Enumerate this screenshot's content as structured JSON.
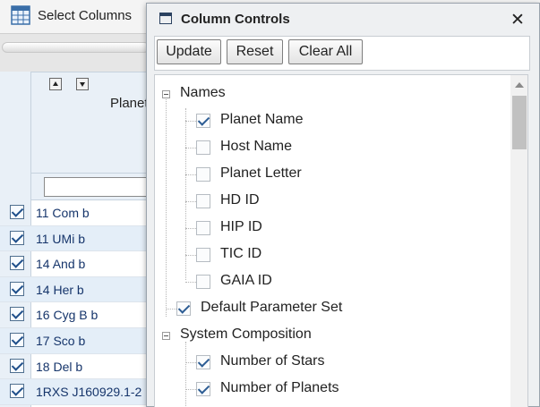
{
  "toolbar": {
    "select_columns_label": "Select Columns",
    "grid_icon": "table-grid-icon",
    "right_fragment": "r"
  },
  "table": {
    "column_header_fragment": "Planet",
    "right_header_fragment": "e\nr",
    "filter_placeholder": "",
    "rows": [
      {
        "name": "11 Com b",
        "checked": true
      },
      {
        "name": "11 UMi b",
        "checked": true
      },
      {
        "name": "14 And b",
        "checked": true
      },
      {
        "name": "14 Her b",
        "checked": true
      },
      {
        "name": "16 Cyg B b",
        "checked": true
      },
      {
        "name": "17 Sco b",
        "checked": true
      },
      {
        "name": "18 Del b",
        "checked": true
      },
      {
        "name": "1RXS J160929.1-2",
        "checked": true
      }
    ]
  },
  "dialog": {
    "title": "Column Controls",
    "title_icon": "window-icon",
    "close_icon": "close-icon",
    "buttons": {
      "update": "Update",
      "reset": "Reset",
      "clear_all": "Clear All"
    },
    "tree": {
      "names_group": "Names",
      "names_items": [
        {
          "label": "Planet Name",
          "checked": true
        },
        {
          "label": "Host Name",
          "checked": false
        },
        {
          "label": "Planet Letter",
          "checked": false
        },
        {
          "label": "HD ID",
          "checked": false
        },
        {
          "label": "HIP ID",
          "checked": false
        },
        {
          "label": "TIC ID",
          "checked": false
        },
        {
          "label": "GAIA ID",
          "checked": false
        }
      ],
      "default_param": {
        "label": "Default Parameter Set",
        "checked": true
      },
      "system_group": "System Composition",
      "system_items": [
        {
          "label": "Number of Stars",
          "checked": true
        },
        {
          "label": "Number of Planets",
          "checked": true
        }
      ]
    }
  }
}
